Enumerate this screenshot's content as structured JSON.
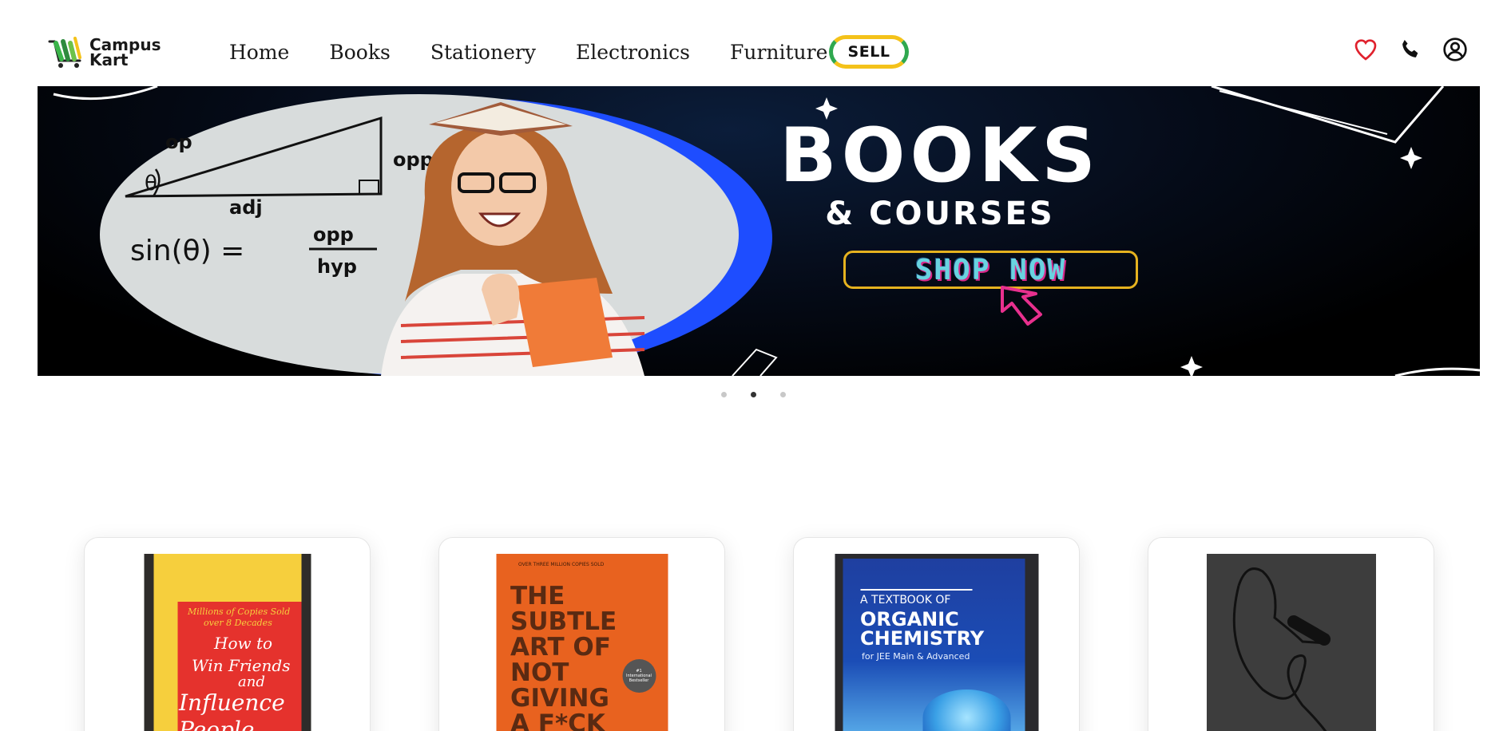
{
  "brand": {
    "name_line1": "Campus",
    "name_line2": "Kart"
  },
  "nav": {
    "items": [
      "Home",
      "Books",
      "Stationery",
      "Electronics",
      "Furniture"
    ],
    "sell_label": "SELL"
  },
  "hero": {
    "title": "BOOKS",
    "subtitle": "& COURSES",
    "cta": "SHOP NOW",
    "board_text": {
      "op": "op",
      "opp": "opp",
      "adj": "adj",
      "formula_lhs": "sin(θ) =",
      "numerator": "opp",
      "denominator": "hyp"
    },
    "slides_total": 3,
    "active_slide": 2
  },
  "products": [
    {
      "cover_line1": "Millions of Copies Sold",
      "cover_line2": "over 8 Decades",
      "title1": "How to",
      "title2": "Win Friends",
      "title3": "and",
      "title4": "Influence",
      "title5": "People"
    },
    {
      "cover_top": "OVER THREE MILLION COPIES SOLD",
      "t1": "THE",
      "t2": "SUBTLE",
      "t3": "ART OF",
      "t4": "NOT",
      "t5": "GIVING",
      "t6": "A F*CK",
      "badge": "#1 International Bestseller"
    },
    {
      "t1": "A TEXTBOOK OF",
      "t2": "ORGANIC",
      "t3": "CHEMISTRY",
      "t4": "for JEE Main & Advanced"
    },
    {
      "item": "earphones"
    }
  ],
  "colors": {
    "heart": "#e0212d",
    "sell_green": "#2fa84f",
    "sell_yellow": "#f4c21a",
    "hero_blue": "#1e4dff",
    "cta_cyan": "#69d3e0",
    "cta_pink": "#d8288a"
  },
  "icons": [
    "heart-icon",
    "phone-icon",
    "user-icon"
  ]
}
